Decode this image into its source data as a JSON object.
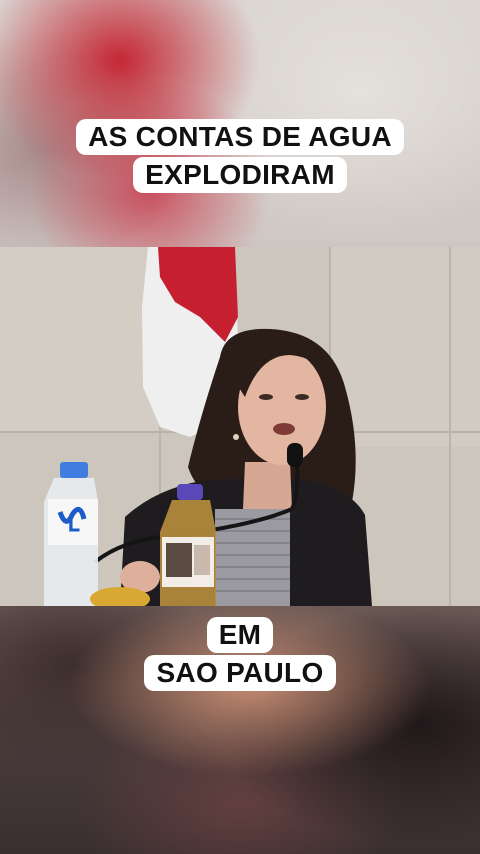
{
  "captions": {
    "top": [
      "AS CONTAS DE AGUA",
      "EXPLODIRAM"
    ],
    "bottom": [
      "EM",
      "SAO PAULO"
    ]
  },
  "colors": {
    "caption_bg": "#ffffff",
    "caption_text": "#111111",
    "flag_red": "#c62030",
    "jacket": "#1f1c1f"
  }
}
